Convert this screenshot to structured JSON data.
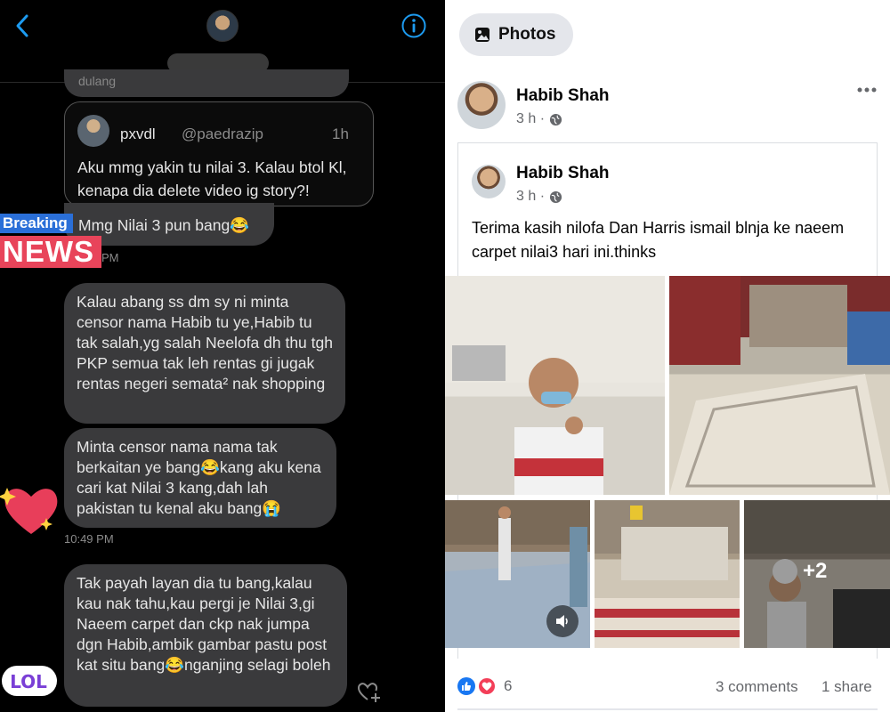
{
  "dm": {
    "clipped_text": "dulang",
    "quote": {
      "name": "pxvdl",
      "handle": "@paedrazip",
      "time": "1h",
      "text": "Aku mmg yakin tu nilai 3. Kalau btol Kl, kenapa dia delete video ig story?!"
    },
    "stickers": {
      "breaking": "Breaking",
      "news": "NEWS",
      "lol": "LOL"
    },
    "messages": [
      {
        "text": "Mmg Nilai 3 pun bang😂",
        "time_fragment": "PM"
      },
      {
        "text": "Kalau abang ss dm sy ni minta censor nama Habib tu ye,Habib tu tak salah,yg salah Neelofa dh thu tgh PKP semua tak leh rentas gi jugak rentas negeri semata² nak shopping"
      },
      {
        "text": "Minta censor nama nama tak berkaitan ye bang😂kang aku kena cari kat Nilai 3 kang,dah lah pakistan tu kenal aku bang😭"
      },
      {
        "text": "Tak payah layan dia tu bang,kalau kau nak tahu,kau pergi je Nilai 3,gi Naeem carpet dan ckp nak jumpa dgn Habib,ambik gambar pastu post kat situ bang😂nganjing selagi boleh"
      }
    ],
    "timestamp": "10:49 PM",
    "colors": {
      "accent": "#1d9bf0",
      "bubble": "#3a3a3c",
      "background": "#000000"
    }
  },
  "fb": {
    "photos_label": "Photos",
    "post": {
      "author": "Habib Shah",
      "time": "3 h ·",
      "shared": {
        "author": "Habib Shah",
        "time": "3 h ·",
        "text": "Terima kasih nilofa Dan Harris ismail  blnja ke naeem carpet nilai3 hari ini.thinks"
      },
      "more_photos": "+2",
      "reaction_count": "6",
      "comments": "3 comments",
      "shares": "1 share"
    },
    "colors": {
      "like": "#1877f2",
      "love": "#f33e58",
      "meta": "#65676b"
    }
  }
}
